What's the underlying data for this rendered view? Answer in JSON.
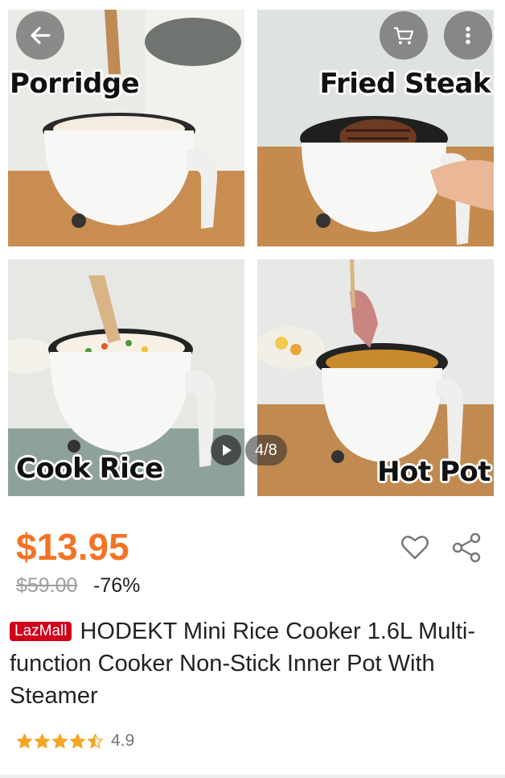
{
  "gallery": {
    "captions": [
      "Porridge",
      "Fried Steak",
      "Cook Rice",
      "Hot Pot"
    ],
    "brand_print": "HODEKT",
    "counter": "4/8"
  },
  "product": {
    "price": "$13.95",
    "original_price": "$59.00",
    "discount": "-76%",
    "badge": "LazMall",
    "title": "HODEKT Mini Rice Cooker 1.6L Multi-function Cooker Non-Stick Inner Pot With Steamer",
    "rating": "4.9",
    "stars": 4.5
  },
  "colors": {
    "price": "#f57224",
    "lazmall_badge": "#d0011b",
    "star": "#f5a623"
  },
  "icons": [
    "back-arrow-icon",
    "cart-icon",
    "more-vertical-icon",
    "play-icon",
    "heart-icon",
    "share-icon",
    "star-icon"
  ]
}
